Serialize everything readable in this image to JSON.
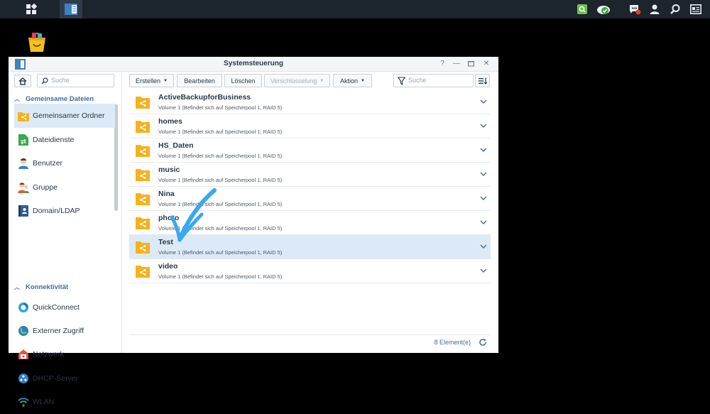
{
  "taskbar": {
    "icons": [
      "main-menu-icon",
      "control-panel-app-icon",
      "search-status-icon",
      "cloud-sync-icon",
      "notifications-icon",
      "user-icon",
      "search-icon",
      "widgets-icon"
    ],
    "notification_badge": "1"
  },
  "desktop": {
    "icon": "package-center-icon"
  },
  "window": {
    "title": "Systemsteuerung",
    "controls": [
      "help-icon",
      "minimize-icon",
      "maximize-icon",
      "close-icon"
    ]
  },
  "sidebar": {
    "search_placeholder": "Suche",
    "sections": [
      {
        "label": "Gemeinsame Dateien"
      },
      {
        "label": "Konnektivität"
      }
    ],
    "items": [
      {
        "label": "Gemeinsamer Ordner",
        "icon": "shared-folder-icon"
      },
      {
        "label": "Dateidienste",
        "icon": "file-services-icon"
      },
      {
        "label": "Benutzer",
        "icon": "user-icon"
      },
      {
        "label": "Gruppe",
        "icon": "group-icon"
      },
      {
        "label": "Domain/LDAP",
        "icon": "domain-ldap-icon"
      },
      {
        "label": "QuickConnect",
        "icon": "quickconnect-icon"
      },
      {
        "label": "Externer Zugriff",
        "icon": "external-access-icon"
      },
      {
        "label": "Netzwerk",
        "icon": "network-icon"
      },
      {
        "label": "DHCP-Server",
        "icon": "dhcp-server-icon"
      },
      {
        "label": "WLAN",
        "icon": "wlan-icon"
      }
    ]
  },
  "toolbar": {
    "create": "Erstellen",
    "edit": "Bearbeiten",
    "delete": "Löschen",
    "encryption": "Verschlüsselung",
    "action": "Aktion",
    "search_placeholder": "Suche"
  },
  "folders": [
    {
      "name": "ActiveBackupforBusiness",
      "desc": "Volume 1 (Befindet sich auf Speicherpool 1, RAID 5)"
    },
    {
      "name": "homes",
      "desc": "Volume 1 (Befindet sich auf Speicherpool 1, RAID 5)"
    },
    {
      "name": "HS_Daten",
      "desc": "Volume 1 (Befindet sich auf Speicherpool 1, RAID 5)"
    },
    {
      "name": "music",
      "desc": "Volume 1 (Befindet sich auf Speicherpool 1, RAID 5)"
    },
    {
      "name": "Nina",
      "desc": "Volume 1 (Befindet sich auf Speicherpool 1, RAID 5)"
    },
    {
      "name": "photo",
      "desc": "Volume 1 (Befindet sich auf Speicherpool 1, RAID 5)"
    },
    {
      "name": "Test",
      "desc": "Volume 1 (Befindet sich auf Speicherpool 1, RAID 5)",
      "selected": true
    },
    {
      "name": "video",
      "desc": "Volume 1 (Befindet sich auf Speicherpool 1, RAID 5)"
    }
  ],
  "footer": {
    "count": "8 Element(e)"
  },
  "colors": {
    "accent": "#3e6d9c",
    "folder": "#f6b21a",
    "selected": "#dceaf7",
    "annotation": "#38a8f0"
  }
}
